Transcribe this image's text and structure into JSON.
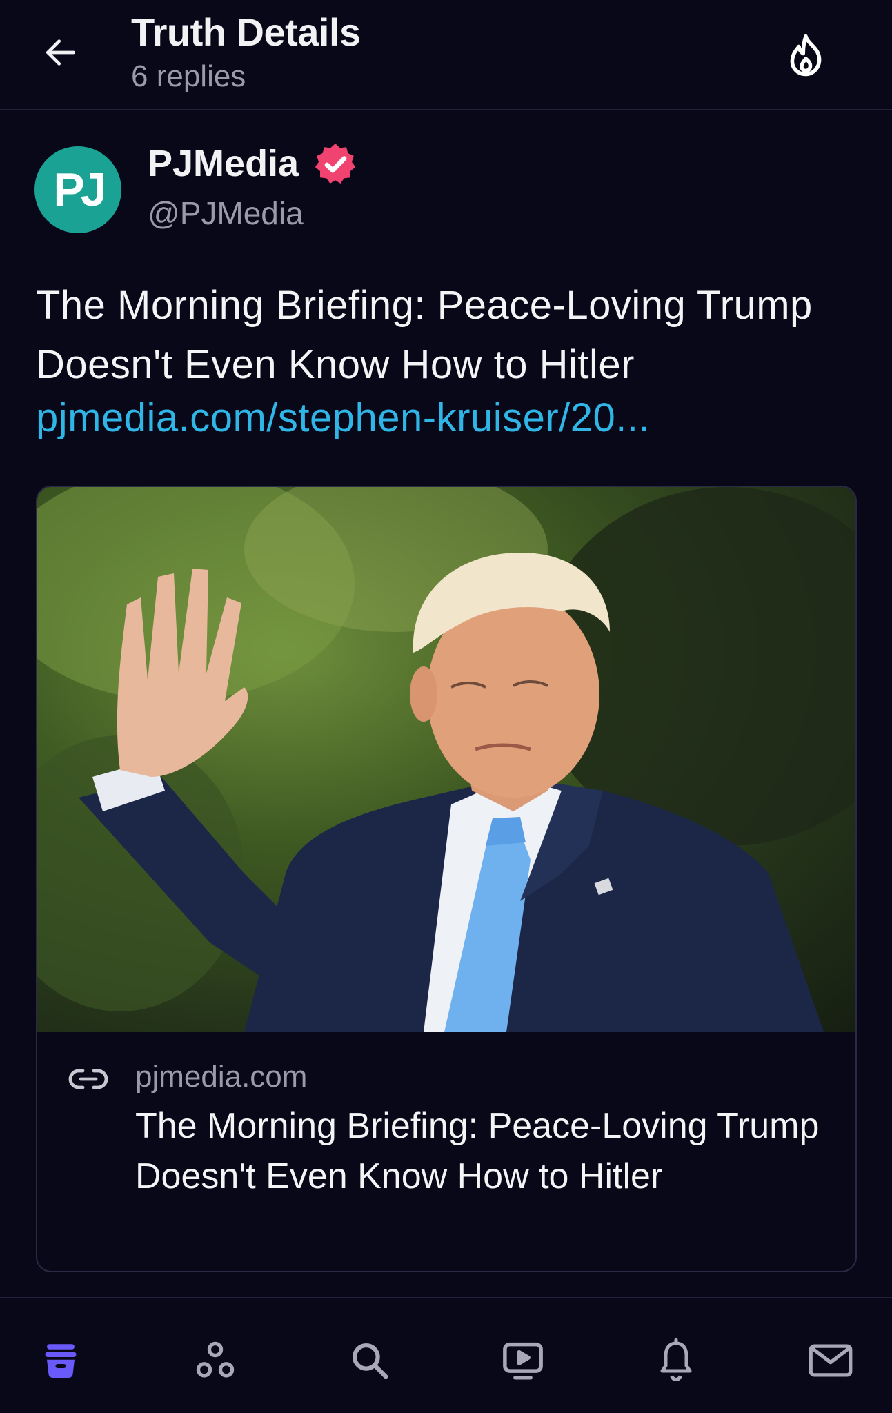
{
  "header": {
    "title": "Truth Details",
    "subtitle": "6 replies"
  },
  "post": {
    "author": {
      "avatar_text": "PJ",
      "name": "PJMedia",
      "handle": "@PJMedia",
      "verified": true
    },
    "text": "The Morning Briefing: Peace-Loving Trump Doesn't Even Know How to Hitler",
    "link": "pjmedia.com/stephen-kruiser/20..."
  },
  "card": {
    "domain": "pjmedia.com",
    "title": "The Morning Briefing: Peace-Loving Trump Doesn't Even Know How to Hitler"
  },
  "bottom_nav": {
    "items": [
      "home-icon",
      "groups-icon",
      "search-icon",
      "video-icon",
      "notifications-icon",
      "messages-icon"
    ],
    "active": "home-icon"
  },
  "colors": {
    "background": "#090819",
    "accent": "#6a5af9",
    "link": "#2fb6e6",
    "verified": "#f0436f",
    "avatar": "#1aa394"
  }
}
